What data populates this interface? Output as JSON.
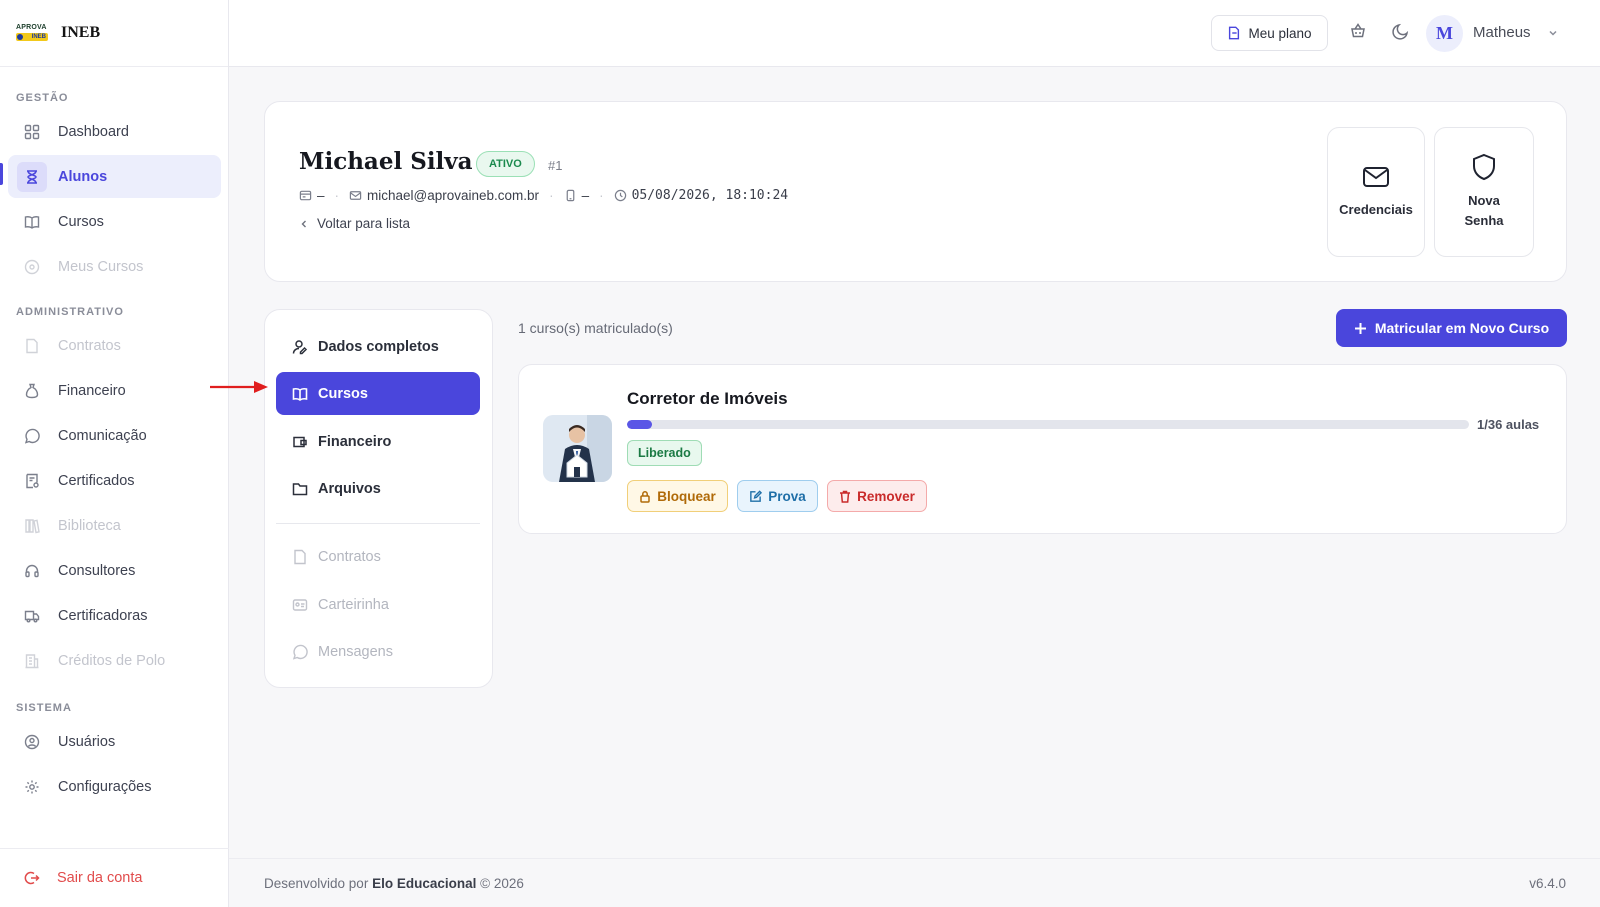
{
  "brand": {
    "logo_top": "APROVA",
    "logo_bottom": "INEB",
    "name": "INEB"
  },
  "sidebar": {
    "sections": [
      {
        "title": "GESTÃO"
      },
      {
        "title": "ADMINISTRATIVO"
      },
      {
        "title": "SISTEMA"
      }
    ],
    "items": [
      {
        "label": "Dashboard",
        "icon": "grid-icon"
      },
      {
        "label": "Alunos",
        "icon": "graduation-icon",
        "active": true
      },
      {
        "label": "Cursos",
        "icon": "book-icon"
      },
      {
        "label": "Meus Cursos",
        "icon": "play-circle-icon",
        "disabled": true
      },
      {
        "label": "Contratos",
        "icon": "file-icon",
        "disabled": true
      },
      {
        "label": "Financeiro",
        "icon": "money-bag-icon"
      },
      {
        "label": "Comunicação",
        "icon": "whatsapp-icon"
      },
      {
        "label": "Certificados",
        "icon": "certificate-icon"
      },
      {
        "label": "Biblioteca",
        "icon": "library-icon",
        "disabled": true
      },
      {
        "label": "Consultores",
        "icon": "headset-icon"
      },
      {
        "label": "Certificadoras",
        "icon": "truck-icon"
      },
      {
        "label": "Créditos de Polo",
        "icon": "building-icon",
        "disabled": true
      },
      {
        "label": "Usuários",
        "icon": "user-shield-icon"
      },
      {
        "label": "Configurações",
        "icon": "gear-icon"
      }
    ],
    "logout": "Sair da conta"
  },
  "topbar": {
    "plan_label": "Meu plano",
    "user_initial": "M",
    "user_name": "Matheus"
  },
  "student": {
    "name": "Michael Silva",
    "status": "ATIVO",
    "id": "#1",
    "document": "–",
    "email": "michael@aprovaineb.com.br",
    "phone": "–",
    "created_at": "05/08/2026, 18:10:24",
    "back_label": "Voltar para lista"
  },
  "actions": {
    "credentials": "Credenciais",
    "new_password_1": "Nova",
    "new_password_2": "Senha"
  },
  "tabs": [
    {
      "label": "Dados completos"
    },
    {
      "label": "Cursos",
      "active": true
    },
    {
      "label": "Financeiro"
    },
    {
      "label": "Arquivos"
    },
    {
      "label": "Contratos",
      "disabled": true
    },
    {
      "label": "Carteirinha",
      "disabled": true
    },
    {
      "label": "Mensagens",
      "disabled": true
    }
  ],
  "courses": {
    "count_label": "1 curso(s) matriculado(s)",
    "enroll_button": "Matricular em Novo Curso",
    "items": [
      {
        "title": "Corretor de Imóveis",
        "progress_completed": 1,
        "progress_total": 36,
        "progress_label": "1/36 aulas",
        "status": "Liberado",
        "buttons": {
          "block": "Bloquear",
          "exam": "Prova",
          "remove": "Remover"
        }
      }
    ]
  },
  "footer": {
    "prefix": "Desenvolvido por",
    "company": "Elo Educacional",
    "suffix": "© 2026",
    "version": "v6.4.0"
  },
  "colors": {
    "accent": "#4a46dc",
    "success": "#1b8a4e",
    "warning": "#b06a08",
    "info": "#1f6fa8",
    "danger": "#c92b2b"
  }
}
